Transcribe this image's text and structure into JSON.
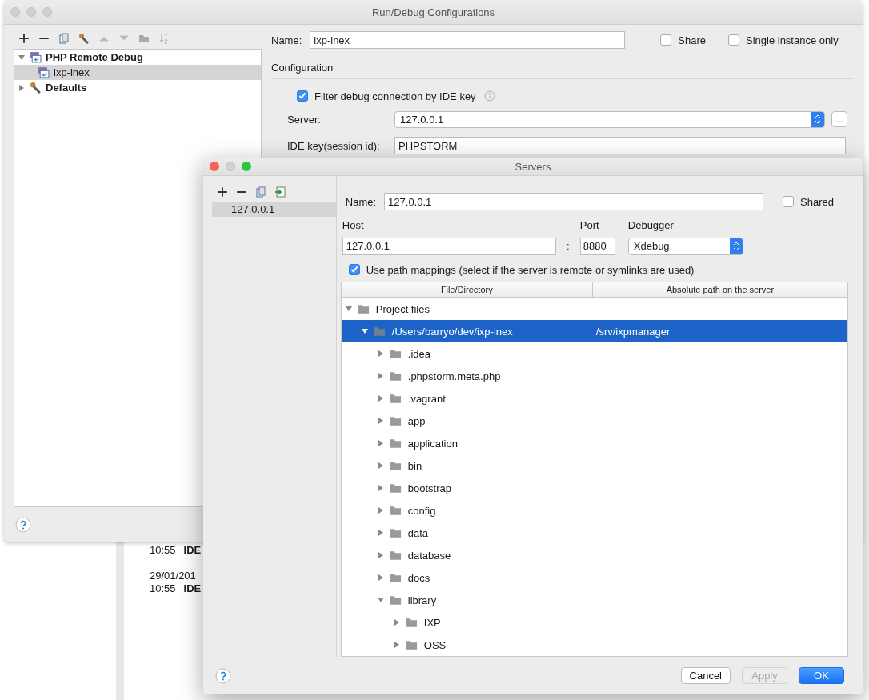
{
  "background_log": [
    [
      "10:55",
      "IDE"
    ],
    [
      "29/01/201"
    ],
    [
      "10:55",
      "IDE"
    ]
  ],
  "run_debug": {
    "title": "Run/Debug Configurations",
    "tree": [
      {
        "label": "PHP Remote Debug",
        "kind": "php",
        "expanded": true,
        "selected": false,
        "children": [
          {
            "label": "ixp-inex",
            "kind": "php",
            "selected": true
          }
        ]
      },
      {
        "label": "Defaults",
        "kind": "defaults",
        "expanded": false,
        "selected": false
      }
    ],
    "name_label": "Name:",
    "name_value": "ixp-inex",
    "share": {
      "label": "Share",
      "checked": false
    },
    "single_instance": {
      "label": "Single instance only",
      "checked": false
    },
    "section": "Configuration",
    "filter": {
      "label": "Filter debug connection by IDE key",
      "checked": true
    },
    "server_label": "Server:",
    "server_value": "127.0.0.1",
    "more_button": "...",
    "ide_key_label": "IDE key(session id):",
    "ide_key_value": "PHPSTORM"
  },
  "servers": {
    "title": "Servers",
    "list": [
      {
        "label": "127.0.0.1",
        "selected": true
      }
    ],
    "name_label": "Name:",
    "name_value": "127.0.0.1",
    "shared": {
      "label": "Shared",
      "checked": false
    },
    "host_label": "Host",
    "host_value": "127.0.0.1",
    "colon": ":",
    "port_label": "Port",
    "port_value": "8880",
    "debugger_label": "Debugger",
    "debugger_value": "Xdebug",
    "path_mappings": {
      "label": "Use path mappings (select if the server is remote or symlinks are used)",
      "checked": true
    },
    "columns": [
      "File/Directory",
      "Absolute path on the server"
    ],
    "tree": [
      {
        "label": "Project files",
        "expanded": true,
        "selected": false,
        "children": [
          {
            "label": "/Users/barryo/dev/ixp-inex",
            "mapping": "/srv/ixpmanager",
            "expanded": true,
            "selected": true,
            "children": [
              {
                "label": ".idea",
                "expanded": false,
                "selected": false
              },
              {
                "label": ".phpstorm.meta.php",
                "expanded": false,
                "selected": false
              },
              {
                "label": ".vagrant",
                "expanded": false,
                "selected": false
              },
              {
                "label": "app",
                "expanded": false,
                "selected": false
              },
              {
                "label": "application",
                "expanded": false,
                "selected": false
              },
              {
                "label": "bin",
                "expanded": false,
                "selected": false
              },
              {
                "label": "bootstrap",
                "expanded": false,
                "selected": false
              },
              {
                "label": "config",
                "expanded": false,
                "selected": false
              },
              {
                "label": "data",
                "expanded": false,
                "selected": false
              },
              {
                "label": "database",
                "expanded": false,
                "selected": false
              },
              {
                "label": "docs",
                "expanded": false,
                "selected": false
              },
              {
                "label": "library",
                "expanded": true,
                "selected": false,
                "children": [
                  {
                    "label": "IXP",
                    "expanded": false,
                    "selected": false
                  },
                  {
                    "label": "OSS",
                    "expanded": false,
                    "selected": false
                  }
                ]
              }
            ]
          }
        ]
      }
    ],
    "buttons": [
      {
        "label": "Cancel",
        "kind": "normal",
        "disabled": false
      },
      {
        "label": "Apply",
        "kind": "normal",
        "disabled": true
      },
      {
        "label": "OK",
        "kind": "primary",
        "disabled": false
      }
    ]
  }
}
